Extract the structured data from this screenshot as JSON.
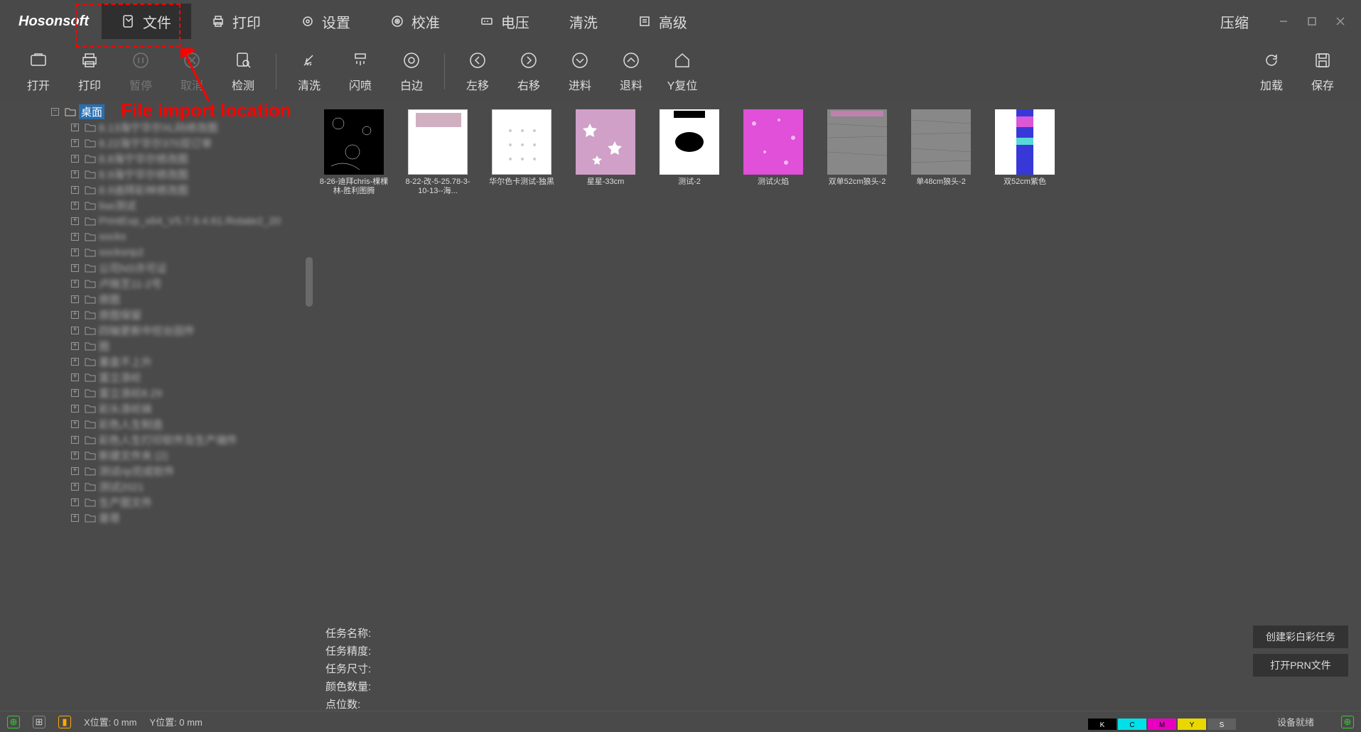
{
  "brand": "Hosonsoft",
  "annotation": "File import location",
  "menu": {
    "items": [
      {
        "label": "文件",
        "icon": "file-icon"
      },
      {
        "label": "打印",
        "icon": "print-icon"
      },
      {
        "label": "设置",
        "icon": "settings-icon"
      },
      {
        "label": "校准",
        "icon": "calibrate-icon"
      },
      {
        "label": "电压",
        "icon": "voltage-icon"
      },
      {
        "label": "清洗",
        "icon": "clean-icon"
      },
      {
        "label": "高级",
        "icon": "advanced-icon"
      }
    ],
    "compress": "压缩"
  },
  "toolbar": {
    "open": "打开",
    "print": "打印",
    "pause": "暂停",
    "cancel": "取消",
    "detect": "检测",
    "clean": "清洗",
    "flash_spray": "闪喷",
    "white_edge": "白边",
    "move_left": "左移",
    "move_right": "右移",
    "feed": "进料",
    "retreat": "退料",
    "y_reset": "Y复位",
    "load": "加载",
    "save": "保存"
  },
  "tree": {
    "root": "桌面",
    "items": [
      "8.13海宁华尔XL码修改图",
      "8.22海宁华尔370双订单",
      "8.8海宁华尔修改图",
      "8.9海宁华尔修改图",
      "8.9迪拜彩林修改图",
      "lise测试",
      "PrintExp_x64_V5.7.9.4.61.Rotate2_20",
      "socks",
      "socksrip2",
      "公司NS许可证",
      "卢晓芝11-2号",
      "原图",
      "原图保留",
      "四轴更新中控台固件",
      "图",
      "墨盒不上升",
      "富立涤纶",
      "富立涤纶8.29",
      "彩头涤纶袜",
      "彩色人生制造",
      "彩色人生打印软件及生产端件",
      "新建文件夹 (2)",
      "测试rip完成软件",
      "测试2021",
      "生产图文件",
      "章哥"
    ]
  },
  "thumbnails": [
    {
      "label": "8-26-迪拜chris-棵棵林-胜利图腾"
    },
    {
      "label": "8-22-改-5-25.78-3-10-13--海..."
    },
    {
      "label": "华尔色卡测试-独黑"
    },
    {
      "label": "星星-33cm"
    },
    {
      "label": "测试-2"
    },
    {
      "label": "测试火焰"
    },
    {
      "label": "双单52cm狼头-2"
    },
    {
      "label": "单48cm狼头-2"
    },
    {
      "label": "双52cm紫色"
    }
  ],
  "info": {
    "task_name": "任务名称:",
    "task_precision": "任务精度:",
    "task_size": "任务尺寸:",
    "color_count": "颜色数量:",
    "dot_count": "点位数:",
    "create_color": "创建彩白彩任务",
    "open_prn": "打开PRN文件"
  },
  "status": {
    "x_pos": "X位置: 0 mm",
    "y_pos": "Y位置: 0 mm",
    "device_ready": "设备就绪",
    "inks": [
      {
        "label": "K",
        "color": "#000000"
      },
      {
        "label": "C",
        "color": "#00e0e8"
      },
      {
        "label": "M",
        "color": "#e800c0"
      },
      {
        "label": "Y",
        "color": "#e8d800"
      },
      {
        "label": "S",
        "color": "#606060"
      }
    ]
  }
}
